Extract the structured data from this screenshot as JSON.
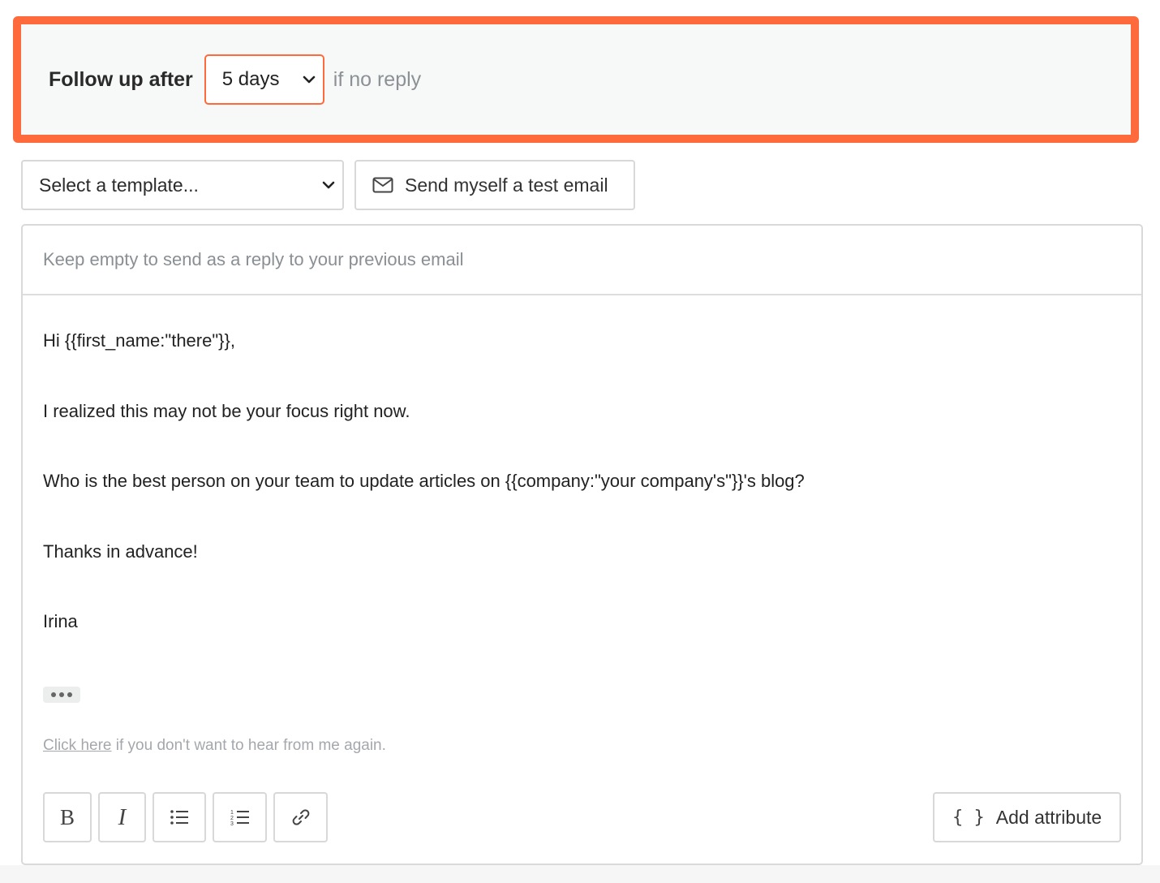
{
  "followup": {
    "label": "Follow up after",
    "delay_value": "5 days",
    "suffix": "if no reply",
    "accent_color": "#ff6a3d"
  },
  "toolbar_top": {
    "template_placeholder": "Select a template...",
    "test_email_label": "Send myself a test email",
    "test_email_icon": "envelope-icon"
  },
  "editor": {
    "subject_placeholder": "Keep empty to send as a reply to your previous email",
    "body_lines": [
      "Hi {{first_name:\"there\"}},",
      "I realized this may not be your focus right now.",
      "Who is the best person on your team to update articles on {{company:\"your company's\"}}'s blog?",
      "Thanks in advance!",
      "Irina"
    ],
    "unsubscribe_link": "Click here",
    "unsubscribe_text": " if you don't want to hear from me again."
  },
  "format_toolbar": {
    "bold_label": "B",
    "italic_label": "I",
    "add_attribute_label": "Add attribute",
    "add_attribute_icon": "{ }"
  }
}
